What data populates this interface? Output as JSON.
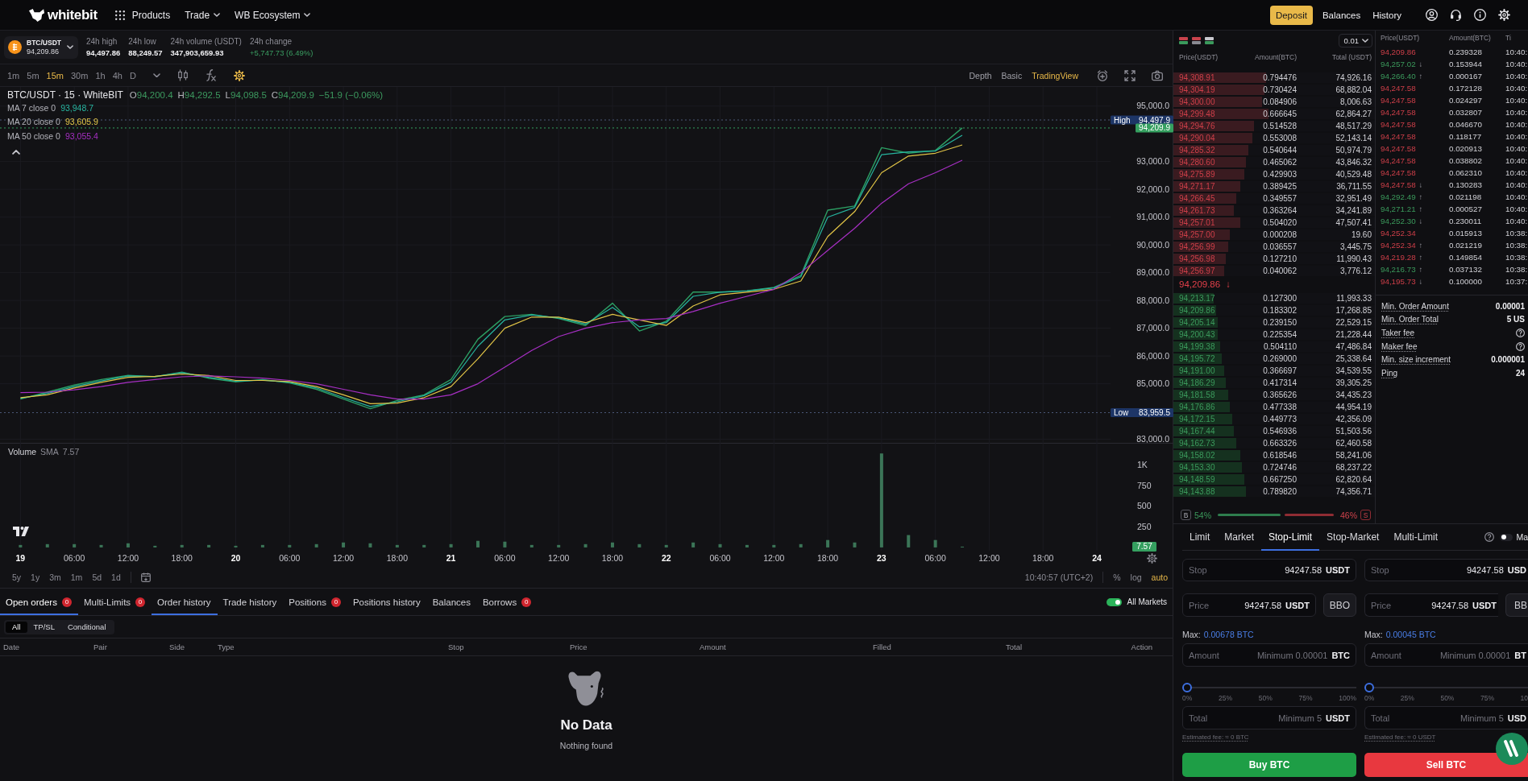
{
  "nav": {
    "logo": "whitebit",
    "menu": [
      {
        "label": "Products",
        "kind": "grid"
      },
      {
        "label": "Trade",
        "kind": "dropdown"
      },
      {
        "label": "WB Ecosystem",
        "kind": "dropdown"
      }
    ],
    "deposit": "Deposit",
    "links": [
      "Balances",
      "History"
    ]
  },
  "ticker": {
    "pair": "BTC/USDT",
    "price": "94,209.86",
    "stats": [
      {
        "label": "24h high",
        "value": "94,497.86",
        "rising": false
      },
      {
        "label": "24h low",
        "value": "88,249.57",
        "rising": false
      },
      {
        "label": "24h volume (USDT)",
        "value": "347,903,659.93",
        "rising": false
      },
      {
        "label": "24h change",
        "value": "+5,747.73 (6.49%)",
        "rising": true
      }
    ]
  },
  "chart_toolbar": {
    "intervals": [
      {
        "label": "1m",
        "selected": false
      },
      {
        "label": "5m",
        "selected": false
      },
      {
        "label": "15m",
        "selected": true
      },
      {
        "label": "30m",
        "selected": false
      },
      {
        "label": "1h",
        "selected": false
      },
      {
        "label": "4h",
        "selected": false
      },
      {
        "label": "D",
        "selected": false
      }
    ],
    "views": [
      {
        "label": "Depth",
        "selected": false
      },
      {
        "label": "Basic",
        "selected": false
      },
      {
        "label": "TradingView",
        "selected": true
      }
    ]
  },
  "chart": {
    "title": "BTC/USDT · 15 · WhiteBIT",
    "ohlc": [
      {
        "key": "O",
        "value": "94,200.4"
      },
      {
        "key": "H",
        "value": "94,292.5"
      },
      {
        "key": "L",
        "value": "94,098.5"
      },
      {
        "key": "C",
        "value": "94,209.9"
      }
    ],
    "change": "−51.9 (−0.06%)",
    "indicators": [
      {
        "label": "MA 7 close 0",
        "value": "93,948.7"
      },
      {
        "label": "MA 20 close 0",
        "value": "93,605.9"
      },
      {
        "label": "MA 50 close 0",
        "value": "93,055.4"
      }
    ],
    "price_tags": [
      {
        "kind": "high",
        "label": "High",
        "value": "94,497.9"
      },
      {
        "kind": "last",
        "value": "94,209.9"
      },
      {
        "kind": "low",
        "label": "Low",
        "value": "83,959.5"
      }
    ],
    "chart_data": {
      "type": "line",
      "categories": [
        null,
        null,
        null,
        null,
        null,
        null,
        null,
        null,
        null,
        null,
        null,
        null,
        null,
        null,
        null,
        null,
        null,
        null,
        null,
        null,
        null,
        null,
        null,
        null,
        null,
        null,
        null,
        null,
        null,
        null,
        null,
        null,
        null,
        null,
        null,
        null,
        null,
        null,
        null,
        null,
        null,
        null
      ],
      "ylim": [
        82872,
        95687
      ],
      "grid": true,
      "yticks": [
        {
          "value": 83000,
          "label": "83,000.0"
        },
        {
          "value": 85000,
          "label": "85,000.0"
        },
        {
          "value": 86000,
          "label": "86,000.0"
        },
        {
          "value": 87000,
          "label": "87,000.0"
        },
        {
          "value": 88000,
          "label": "88,000.0"
        },
        {
          "value": 89000,
          "label": "89,000.0"
        },
        {
          "value": 90000,
          "label": "90,000.0"
        },
        {
          "value": 91000,
          "label": "91,000.0"
        },
        {
          "value": 92000,
          "label": "92,000.0"
        },
        {
          "value": 93000,
          "label": "93,000.0"
        },
        {
          "value": 95000,
          "label": "95,000.0"
        }
      ],
      "series": [
        {
          "color": "#2c9e63",
          "values": [
            null,
            84450,
            84700,
            84950,
            85150,
            85300,
            85250,
            85420,
            85200,
            85070,
            85150,
            85030,
            84800,
            84450,
            84100,
            84400,
            84600,
            85150,
            86600,
            87420,
            87500,
            87350,
            87100,
            87900,
            86900,
            87250,
            88300,
            88300,
            88350,
            88470,
            88900,
            91250,
            91400,
            93500,
            93300,
            93400,
            94210,
            null,
            null,
            null,
            null,
            null
          ]
        },
        {
          "color": "#27b5a0",
          "values": [
            null,
            84470,
            84650,
            84900,
            85100,
            85280,
            85260,
            85400,
            85230,
            85090,
            85130,
            85050,
            84850,
            84500,
            84180,
            84350,
            84570,
            85050,
            86350,
            87300,
            87480,
            87370,
            87150,
            87750,
            87050,
            87200,
            88150,
            88300,
            88340,
            88450,
            88850,
            91000,
            91350,
            93250,
            93350,
            93380,
            93950,
            null,
            null,
            null,
            null,
            null
          ]
        },
        {
          "color": "#e2c547",
          "values": [
            null,
            84500,
            84600,
            84850,
            85050,
            85230,
            85270,
            85350,
            85300,
            85120,
            85120,
            85080,
            84900,
            84600,
            84280,
            84300,
            84500,
            84900,
            85900,
            87000,
            87400,
            87400,
            87200,
            87500,
            87300,
            87100,
            87800,
            88200,
            88300,
            88400,
            88700,
            90300,
            91200,
            92600,
            93200,
            93300,
            93600,
            null,
            null,
            null,
            null,
            null
          ]
        },
        {
          "color": "#a72fc4",
          "values": [
            null,
            84680,
            84700,
            84780,
            84900,
            85050,
            85150,
            85250,
            85280,
            85250,
            85200,
            85120,
            85000,
            84800,
            84600,
            84450,
            84450,
            84600,
            85000,
            85600,
            86200,
            86700,
            87000,
            87200,
            87300,
            87350,
            87600,
            87900,
            88150,
            88400,
            89000,
            89800,
            90600,
            91500,
            92200,
            92600,
            93050,
            null,
            null,
            null,
            null,
            null
          ]
        }
      ],
      "ref_lines": [
        {
          "axis": "y",
          "value": 94497.9
        },
        {
          "axis": "y",
          "value": 94209.9
        },
        {
          "axis": "y",
          "value": 83959.5
        }
      ]
    }
  },
  "volume": {
    "indicator": "SMA",
    "value": "7.57",
    "last_tag": "7.57",
    "chart_data": {
      "type": "bar",
      "categories": [
        null,
        "19",
        null,
        "06:00",
        null,
        "12:00",
        null,
        "18:00",
        null,
        "20",
        null,
        "06:00",
        null,
        "12:00",
        null,
        "18:00",
        null,
        "21",
        null,
        "06:00",
        null,
        "12:00",
        null,
        "18:00",
        null,
        "22",
        null,
        "06:00",
        null,
        "12:00",
        null,
        "18:00",
        null,
        "23",
        null,
        "06:00",
        null,
        "12:00",
        null,
        "18:00",
        null,
        "24"
      ],
      "ylim": [
        -40,
        1269
      ],
      "grid": true,
      "series": [
        {
          "name": "Volume",
          "color": "#3b7557",
          "values": [
            null,
            30,
            40,
            40,
            30,
            50,
            20,
            30,
            30,
            20,
            30,
            30,
            40,
            60,
            50,
            30,
            30,
            40,
            80,
            70,
            30,
            30,
            40,
            60,
            40,
            30,
            60,
            40,
            30,
            30,
            40,
            90,
            60,
            1140,
            150,
            90,
            10,
            null,
            null,
            null,
            null,
            null
          ]
        }
      ],
      "yticks": [
        {
          "value": 250,
          "label": "250"
        },
        {
          "value": 500,
          "label": "500"
        },
        {
          "value": 750,
          "label": "750"
        },
        {
          "value": 1000,
          "label": "1K"
        }
      ]
    }
  },
  "chart_footer": {
    "ranges": [
      "5y",
      "1y",
      "3m",
      "1m",
      "5d",
      "1d"
    ],
    "clock": "10:40:57 (UTC+2)",
    "scales": [
      {
        "label": "%",
        "selected": false
      },
      {
        "label": "log",
        "selected": false
      },
      {
        "label": "auto",
        "selected": true
      }
    ]
  },
  "orders": {
    "tabs": [
      {
        "label": "Open orders",
        "count": "0",
        "selected": true,
        "hover": false
      },
      {
        "label": "Multi-Limits",
        "count": "0",
        "selected": false,
        "hover": false
      },
      {
        "label": "Order history",
        "selected": false,
        "hover": true
      },
      {
        "label": "Trade history",
        "selected": false,
        "hover": false
      },
      {
        "label": "Positions",
        "count": "0",
        "selected": false,
        "hover": false
      },
      {
        "label": "Positions history",
        "selected": false,
        "hover": false
      },
      {
        "label": "Balances",
        "selected": false,
        "hover": false
      },
      {
        "label": "Borrows",
        "count": "0",
        "selected": false,
        "hover": false
      }
    ],
    "all_markets": {
      "label": "All Markets",
      "on": true
    },
    "filters": [
      {
        "label": "All",
        "selected": true
      },
      {
        "label": "TP/SL",
        "selected": false
      },
      {
        "label": "Conditional",
        "selected": false
      }
    ],
    "columns": [
      "Date",
      "Pair",
      "Side",
      "Type",
      "Stop",
      "Price",
      "Amount",
      "Filled",
      "Total",
      "Action"
    ],
    "empty": {
      "title": "No Data",
      "text": "Nothing found"
    }
  },
  "order_book": {
    "step": "0.01",
    "columns": [
      "Price(USDT)",
      "Amount(BTC)",
      "Total (USDT)"
    ],
    "asks": [
      {
        "price": "94,308.91",
        "amount": "0.794476",
        "total": "74,926.16",
        "level": 0.46
      },
      {
        "price": "94,304.19",
        "amount": "0.730424",
        "total": "68,882.04",
        "level": 0.45
      },
      {
        "price": "94,300.00",
        "amount": "0.084906",
        "total": "8,006.63",
        "level": 0.44
      },
      {
        "price": "94,299.48",
        "amount": "0.666645",
        "total": "62,864.27",
        "level": 0.47
      },
      {
        "price": "94,294.76",
        "amount": "0.514528",
        "total": "48,517.29",
        "level": 0.4
      },
      {
        "price": "94,290.04",
        "amount": "0.553008",
        "total": "52,143.14",
        "level": 0.39
      },
      {
        "price": "94,285.32",
        "amount": "0.540644",
        "total": "50,974.79",
        "level": 0.37
      },
      {
        "price": "94,280.60",
        "amount": "0.465062",
        "total": "43,846.32",
        "level": 0.36
      },
      {
        "price": "94,275.89",
        "amount": "0.429903",
        "total": "40,529.48",
        "level": 0.35
      },
      {
        "price": "94,271.17",
        "amount": "0.389425",
        "total": "36,711.55",
        "level": 0.33
      },
      {
        "price": "94,266.45",
        "amount": "0.349557",
        "total": "32,951.49",
        "level": 0.31
      },
      {
        "price": "94,261.73",
        "amount": "0.363264",
        "total": "34,241.89",
        "level": 0.3
      },
      {
        "price": "94,257.01",
        "amount": "0.504020",
        "total": "47,507.41",
        "level": 0.33
      },
      {
        "price": "94,257.00",
        "amount": "0.000208",
        "total": "19.60",
        "level": 0.28
      },
      {
        "price": "94,256.99",
        "amount": "0.036557",
        "total": "3,445.75",
        "level": 0.27
      },
      {
        "price": "94,256.98",
        "amount": "0.127210",
        "total": "11,990.43",
        "level": 0.26
      },
      {
        "price": "94,256.97",
        "amount": "0.040062",
        "total": "3,776.12",
        "level": 0.25
      }
    ],
    "last": {
      "price": "94,209.86",
      "arrow": "↓"
    },
    "bids": [
      {
        "price": "94,213.17",
        "amount": "0.127300",
        "total": "11,993.33",
        "level": 0.2
      },
      {
        "price": "94,209.86",
        "amount": "0.183302",
        "total": "17,268.85",
        "level": 0.21
      },
      {
        "price": "94,205.14",
        "amount": "0.239150",
        "total": "22,529.15",
        "level": 0.22
      },
      {
        "price": "94,200.43",
        "amount": "0.225354",
        "total": "21,228.44",
        "level": 0.22
      },
      {
        "price": "94,199.38",
        "amount": "0.504110",
        "total": "47,486.84",
        "level": 0.23
      },
      {
        "price": "94,195.72",
        "amount": "0.269000",
        "total": "25,338.64",
        "level": 0.24
      },
      {
        "price": "94,191.00",
        "amount": "0.366697",
        "total": "34,539.55",
        "level": 0.25
      },
      {
        "price": "94,186.29",
        "amount": "0.417314",
        "total": "39,305.25",
        "level": 0.26
      },
      {
        "price": "94,181.58",
        "amount": "0.365626",
        "total": "34,435.23",
        "level": 0.27
      },
      {
        "price": "94,176.86",
        "amount": "0.477338",
        "total": "44,954.19",
        "level": 0.28
      },
      {
        "price": "94,172.15",
        "amount": "0.449773",
        "total": "42,356.09",
        "level": 0.29
      },
      {
        "price": "94,167.44",
        "amount": "0.546936",
        "total": "51,503.56",
        "level": 0.3
      },
      {
        "price": "94,162.73",
        "amount": "0.663326",
        "total": "62,460.58",
        "level": 0.31
      },
      {
        "price": "94,158.02",
        "amount": "0.618546",
        "total": "58,241.06",
        "level": 0.33
      },
      {
        "price": "94,153.30",
        "amount": "0.724746",
        "total": "68,237.22",
        "level": 0.34
      },
      {
        "price": "94,148.59",
        "amount": "0.667250",
        "total": "62,820.64",
        "level": 0.35
      },
      {
        "price": "94,143.88",
        "amount": "0.789820",
        "total": "74,356.71",
        "level": 0.36
      }
    ],
    "ratio": {
      "buy_mark": "B",
      "buy": "54%",
      "sell": "46%",
      "sell_mark": "S",
      "level": 0.54
    }
  },
  "trades": {
    "columns": [
      "Price(USDT)",
      "Amount(BTC)",
      "Ti"
    ],
    "rows": [
      {
        "price": "94,209.86",
        "buy": false,
        "amount": "0.239328",
        "time": "10:40:"
      },
      {
        "price": "94,257.02",
        "arrow": "↓",
        "buy": true,
        "amount": "0.153944",
        "time": "10:40:"
      },
      {
        "price": "94,266.40",
        "arrow": "↑",
        "buy": true,
        "amount": "0.000167",
        "time": "10:40:"
      },
      {
        "price": "94,247.58",
        "buy": false,
        "amount": "0.172128",
        "time": "10:40:"
      },
      {
        "price": "94,247.58",
        "buy": false,
        "amount": "0.024297",
        "time": "10:40:"
      },
      {
        "price": "94,247.58",
        "buy": false,
        "amount": "0.032807",
        "time": "10:40:"
      },
      {
        "price": "94,247.58",
        "buy": false,
        "amount": "0.046670",
        "time": "10:40:"
      },
      {
        "price": "94,247.58",
        "buy": false,
        "amount": "0.118177",
        "time": "10:40:"
      },
      {
        "price": "94,247.58",
        "buy": false,
        "amount": "0.020913",
        "time": "10:40:"
      },
      {
        "price": "94,247.58",
        "buy": false,
        "amount": "0.038802",
        "time": "10:40:"
      },
      {
        "price": "94,247.58",
        "buy": false,
        "amount": "0.062310",
        "time": "10:40:"
      },
      {
        "price": "94,247.58",
        "arrow": "↓",
        "buy": false,
        "amount": "0.130283",
        "time": "10:40:"
      },
      {
        "price": "94,292.49",
        "arrow": "↑",
        "buy": true,
        "amount": "0.021198",
        "time": "10:40:"
      },
      {
        "price": "94,271.21",
        "arrow": "↑",
        "buy": true,
        "amount": "0.000527",
        "time": "10:40:"
      },
      {
        "price": "94,252.30",
        "arrow": "↓",
        "buy": true,
        "amount": "0.230011",
        "time": "10:40:"
      },
      {
        "price": "94,252.34",
        "buy": false,
        "amount": "0.015913",
        "time": "10:38:"
      },
      {
        "price": "94,252.34",
        "arrow": "↑",
        "buy": false,
        "amount": "0.021219",
        "time": "10:38:"
      },
      {
        "price": "94,219.28",
        "arrow": "↑",
        "buy": false,
        "amount": "0.149854",
        "time": "10:38:"
      },
      {
        "price": "94,216.73",
        "arrow": "↑",
        "buy": true,
        "amount": "0.037132",
        "time": "10:38:"
      },
      {
        "price": "94,195.73",
        "arrow": "↓",
        "buy": false,
        "amount": "0.100000",
        "time": "10:37:"
      }
    ]
  },
  "market_info": [
    {
      "label": "Min. Order Amount",
      "kind": "value",
      "value": "0.00001"
    },
    {
      "label": "Min. Order Total",
      "kind": "value",
      "value": "5 US"
    },
    {
      "label": "Taker fee",
      "kind": "help"
    },
    {
      "label": "Maker fee",
      "kind": "help"
    },
    {
      "label": "Min. size increment",
      "kind": "value",
      "value": "0.000001"
    },
    {
      "label": "Ping",
      "kind": "value",
      "value": "24"
    }
  ],
  "order_form": {
    "types": [
      {
        "label": "Limit",
        "selected": false
      },
      {
        "label": "Market",
        "selected": false
      },
      {
        "label": "Stop-Limit",
        "selected": true
      },
      {
        "label": "Stop-Market",
        "selected": false
      },
      {
        "label": "Multi-Limit",
        "selected": false
      }
    ],
    "margin": {
      "label": "Ma",
      "on": false
    },
    "sides": [
      {
        "kind": "buy",
        "stop": {
          "label": "Stop",
          "value": "94247.58",
          "unit": "USDT"
        },
        "price": {
          "label": "Price",
          "value": "94247.58",
          "unit": "USDT"
        },
        "bbo": "BBO",
        "max_label": "Max:",
        "max": "0.00678 BTC",
        "amount": {
          "label": "Amount",
          "placeholder": "Minimum 0.00001",
          "unit": "BTC"
        },
        "level": 0,
        "marks": [
          "0%",
          "25%",
          "50%",
          "75%",
          "100%"
        ],
        "total": {
          "label": "Total",
          "placeholder": "Minimum 5",
          "unit": "USDT"
        },
        "fee": "Estimated fee: ≈ 0 BTC",
        "button": "Buy BTC"
      },
      {
        "kind": "sell",
        "stop": {
          "label": "Stop",
          "value": "94247.58",
          "unit": "USD"
        },
        "price": {
          "label": "Price",
          "value": "94247.58",
          "unit": "USDT"
        },
        "bbo": "BB",
        "max_label": "Max:",
        "max": "0.00045 BTC",
        "amount": {
          "label": "Amount",
          "placeholder": "Minimum 0.00001",
          "unit": "BT"
        },
        "level": 0,
        "marks": [
          "0%",
          "25%",
          "50%",
          "75%",
          "10"
        ],
        "total": {
          "label": "Total",
          "placeholder": "Minimum 5",
          "unit": "USD"
        },
        "fee": "Estimated fee: ≈ 0 USDT",
        "button": "Sell BTC"
      }
    ]
  }
}
